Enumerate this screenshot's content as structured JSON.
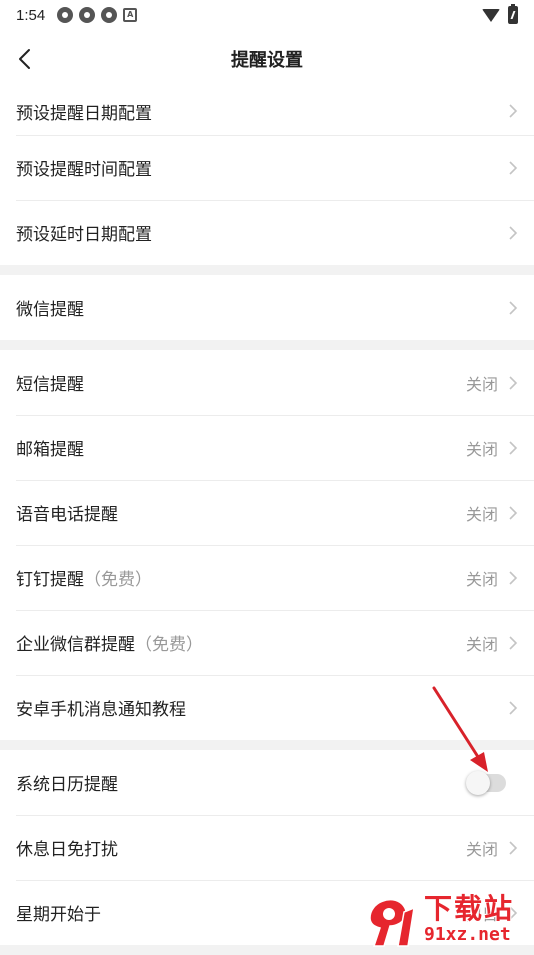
{
  "status_bar": {
    "time": "1:54",
    "icons": [
      "app-icon",
      "app-icon",
      "app-icon",
      "a-icon"
    ],
    "right_icons": [
      "wifi-icon",
      "battery-icon"
    ]
  },
  "header": {
    "title": "提醒设置",
    "back_icon": "chevron-left-icon"
  },
  "groups": [
    {
      "items": [
        {
          "label": "预设提醒日期配置",
          "value": ""
        },
        {
          "label": "预设提醒时间配置",
          "value": ""
        },
        {
          "label": "预设延时日期配置",
          "value": ""
        }
      ]
    },
    {
      "items": [
        {
          "label": "微信提醒",
          "value": ""
        }
      ]
    },
    {
      "items": [
        {
          "label": "短信提醒",
          "value": "关闭"
        },
        {
          "label": "邮箱提醒",
          "value": "关闭"
        },
        {
          "label": "语音电话提醒",
          "value": "关闭"
        },
        {
          "label": "钉钉提醒",
          "note": "（免费）",
          "value": "关闭"
        },
        {
          "label": "企业微信群提醒",
          "note": "（免费）",
          "value": "关闭"
        },
        {
          "label": "安卓手机消息通知教程",
          "value": ""
        }
      ]
    },
    {
      "items": [
        {
          "label": "系统日历提醒",
          "toggle": false
        },
        {
          "label": "休息日免打扰",
          "value": "关闭"
        },
        {
          "label": "星期开始于",
          "value": "周日"
        }
      ]
    }
  ],
  "colors": {
    "background": "#f2f2f2",
    "secondary_text": "#999999",
    "annotation_arrow": "#d8222a",
    "watermark": "#e6262e"
  },
  "watermark": {
    "brand": "下载站",
    "url": "91xz.net"
  }
}
